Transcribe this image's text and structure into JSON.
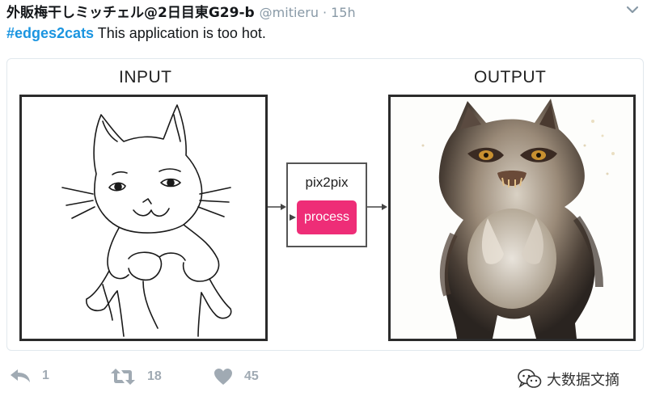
{
  "tweet": {
    "author_name": "外販梅干しミッチェル@2日目東G29-b",
    "author_handle": "@mitieru",
    "separator": "·",
    "timestamp": "15h",
    "hashtag": "#edges2cats",
    "text": " This application is too hot."
  },
  "media": {
    "input_label": "INPUT",
    "output_label": "OUTPUT",
    "model_name": "pix2pix",
    "process_button": "process"
  },
  "actions": {
    "reply_count": "1",
    "retweet_count": "18",
    "like_count": "45"
  },
  "watermark": {
    "text": "大数据文摘"
  },
  "colors": {
    "hashtag": "#1b95e0",
    "process_button": "#ee2d77",
    "muted": "#8899a6",
    "action_gray": "#a0aab3"
  }
}
